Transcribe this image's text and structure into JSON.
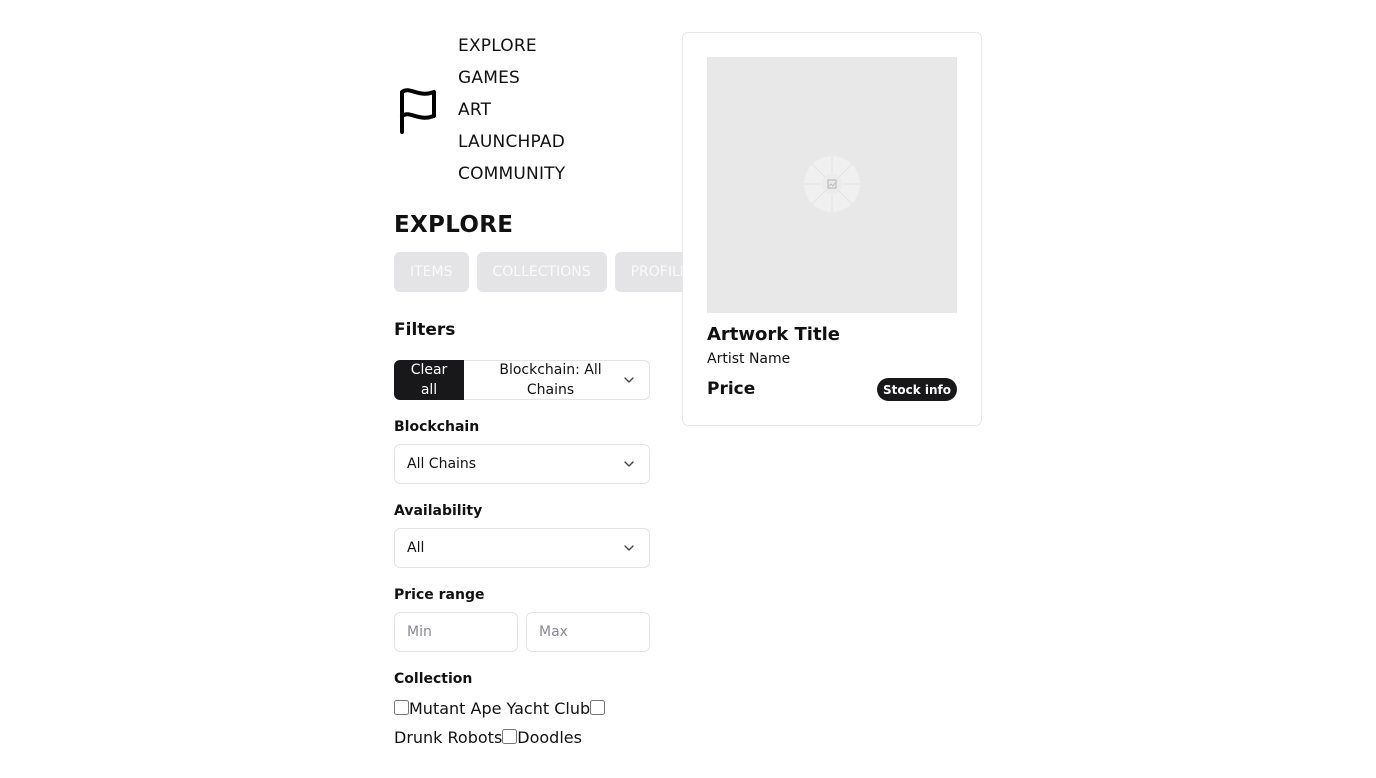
{
  "nav": {
    "items": [
      "EXPLORE",
      "GAMES",
      "ART",
      "LAUNCHPAD",
      "COMMUNITY"
    ],
    "logo_icon": "flag-icon"
  },
  "explore": {
    "title": "EXPLORE",
    "tabs": [
      "ITEMS",
      "COLLECTIONS",
      "PROFILES"
    ]
  },
  "filters": {
    "title": "Filters",
    "clear_all": "Clear all",
    "active_chip": "Blockchain: All Chains",
    "blockchain": {
      "label": "Blockchain",
      "value": "All Chains"
    },
    "availability": {
      "label": "Availability",
      "value": "All"
    },
    "price_range": {
      "label": "Price range",
      "min_placeholder": "Min",
      "max_placeholder": "Max"
    },
    "collection": {
      "label": "Collection",
      "options": [
        "Mutant Ape Yacht Club",
        "Drunk Robots",
        "Doodles"
      ]
    }
  },
  "card": {
    "title": "Artwork Title",
    "artist": "Artist Name",
    "price": "Price",
    "stock_button": "Stock info",
    "image_icon": "image-placeholder-icon"
  },
  "colors": {
    "primary": "#18181b",
    "border": "#e4e4e7",
    "tab_bg": "#e4e4e7",
    "media_bg": "#e8e8e8"
  }
}
